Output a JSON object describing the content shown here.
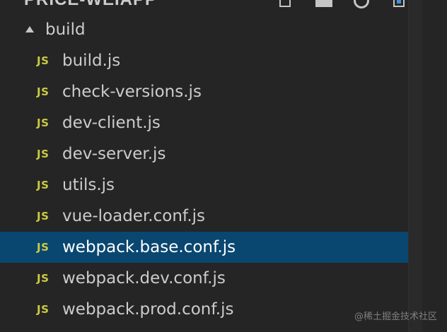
{
  "explorer": {
    "section_title": "PRICE-WEIAPP",
    "toolbar_icons": [
      "new-file-icon",
      "new-folder-icon",
      "refresh-icon",
      "collapse-all-icon"
    ]
  },
  "tree": {
    "folder": {
      "name": "build",
      "expanded": true
    },
    "file_icon_text": "JS",
    "file_icon_color": "#cbcb41",
    "files": [
      {
        "name": "build.js"
      },
      {
        "name": "check-versions.js"
      },
      {
        "name": "dev-client.js"
      },
      {
        "name": "dev-server.js"
      },
      {
        "name": "utils.js"
      },
      {
        "name": "vue-loader.conf.js"
      },
      {
        "name": "webpack.base.conf.js",
        "selected": true
      },
      {
        "name": "webpack.dev.conf.js"
      },
      {
        "name": "webpack.prod.conf.js"
      }
    ],
    "selected_background": "#094771"
  },
  "watermark": "@稀土掘金技术社区"
}
